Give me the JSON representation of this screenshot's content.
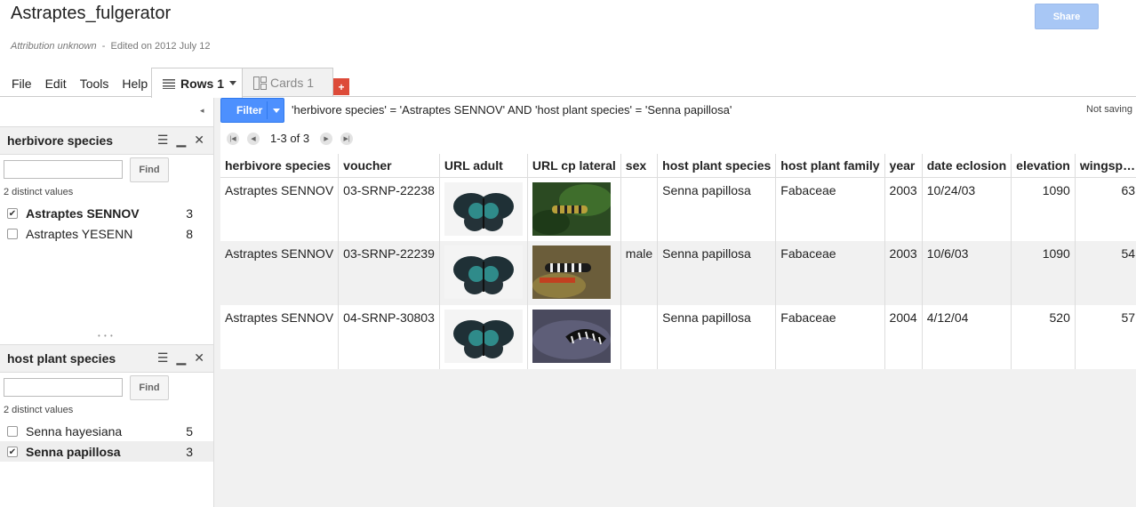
{
  "header": {
    "title": "Astraptes_fulgerator",
    "attribution": "Attribution unknown",
    "edited": "Edited on 2012 July 12",
    "share_label": "Share"
  },
  "menu": [
    "File",
    "Edit",
    "Tools",
    "Help"
  ],
  "tabs": [
    {
      "label": "Rows 1",
      "active": true,
      "icon": "list-icon"
    },
    {
      "label": "Cards 1",
      "active": false,
      "icon": "cards-icon"
    }
  ],
  "add_tab_label": "+",
  "filters": [
    {
      "title": "herbivore species",
      "find_label": "Find",
      "search_value": "",
      "distinct": "2 distinct values",
      "values": [
        {
          "label": "Astraptes SENNOV",
          "count": "3",
          "checked": true
        },
        {
          "label": "Astraptes YESENN",
          "count": "8",
          "checked": false
        }
      ]
    },
    {
      "title": "host plant species",
      "find_label": "Find",
      "search_value": "",
      "distinct": "2 distinct values",
      "values": [
        {
          "label": "Senna hayesiana",
          "count": "5",
          "checked": false
        },
        {
          "label": "Senna papillosa",
          "count": "3",
          "checked": true
        }
      ]
    }
  ],
  "filter_button_label": "Filter",
  "query": "'herbivore species' = 'Astraptes SENNOV' AND 'host plant species' = 'Senna papillosa'",
  "save_status": "Not saving",
  "pager_text": "1-3 of 3",
  "table": {
    "columns": [
      "herbivore species",
      "voucher",
      "URL adult",
      "URL cp lateral",
      "sex",
      "host plant species",
      "host plant family",
      "year",
      "date eclosion",
      "elevation",
      "wingsp…"
    ],
    "rows": [
      [
        "Astraptes SENNOV",
        "03-SRNP-22238",
        "",
        "",
        "",
        "Senna papillosa",
        "Fabaceae",
        "2003",
        "10/24/03",
        "1090",
        "63"
      ],
      [
        "Astraptes SENNOV",
        "03-SRNP-22239",
        "",
        "",
        "male",
        "Senna papillosa",
        "Fabaceae",
        "2003",
        "10/6/03",
        "1090",
        "54"
      ],
      [
        "Astraptes SENNOV",
        "04-SRNP-30803",
        "",
        "",
        "",
        "Senna papillosa",
        "Fabaceae",
        "2004",
        "4/12/04",
        "520",
        "57"
      ]
    ]
  },
  "colors": {
    "accent": "#4d90fe",
    "add_tab": "#dd4b39",
    "share": "#a8c7f5"
  }
}
